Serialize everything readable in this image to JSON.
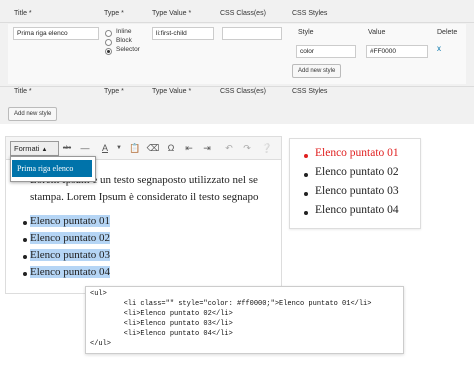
{
  "styles_table": {
    "headers": {
      "title": "Title *",
      "type": "Type *",
      "type_value": "Type Value *",
      "css_classes": "CSS Class(es)",
      "css_styles": "CSS Styles"
    },
    "row": {
      "title_value": "Prima riga elenco",
      "type_options": [
        "Inline",
        "Block",
        "Selector"
      ],
      "selected_type": "Selector",
      "type_value": "li:first-child",
      "css_classes": "",
      "style_headers": {
        "style": "Style",
        "value": "Value",
        "delete": "Delete"
      },
      "style_row": {
        "style": "color",
        "value": "#FF0000",
        "delete": "x"
      },
      "add_style_label": "Add new style"
    },
    "footer_headers": {
      "title": "Title *",
      "type": "Type *",
      "type_value": "Type Value *",
      "css_classes": "CSS Class(es)",
      "css_styles": "CSS Styles"
    },
    "add_new_style_label": "Add new style"
  },
  "editor": {
    "formats_label": "Formati",
    "toolbar_icons": [
      "abc-strikethrough-icon",
      "horizontal-line-icon",
      "text-color-icon",
      "paste-as-text-icon",
      "clear-formatting-icon",
      "omega-special-character-icon",
      "outdent-icon",
      "indent-icon",
      "undo-icon",
      "redo-icon",
      "help-icon"
    ],
    "dropdown_item": "Prima riga elenco",
    "paragraph_line1": "Lorem Ipsum è un testo segnaposto utilizzato nel se",
    "paragraph_line2": "stampa. Lorem Ipsum è considerato il testo segnapo",
    "list_items": [
      "Elenco puntato 01",
      "Elenco puntato 02",
      "Elenco puntato 03",
      "Elenco puntato 04"
    ]
  },
  "preview": {
    "items": [
      "Elenco puntato 01",
      "Elenco puntato 02",
      "Elenco puntato 03",
      "Elenco puntato 04"
    ],
    "first_item_color": "#e02020"
  },
  "code": {
    "lines": [
      "<ul>",
      "        <li class=\"\" style=\"color: #ff0000;\">Elenco puntato 01</li>",
      "        <li>Elenco puntato 02</li>",
      "        <li>Elenco puntato 03</li>",
      "        <li>Elenco puntato 04</li>",
      "</ul>"
    ]
  }
}
